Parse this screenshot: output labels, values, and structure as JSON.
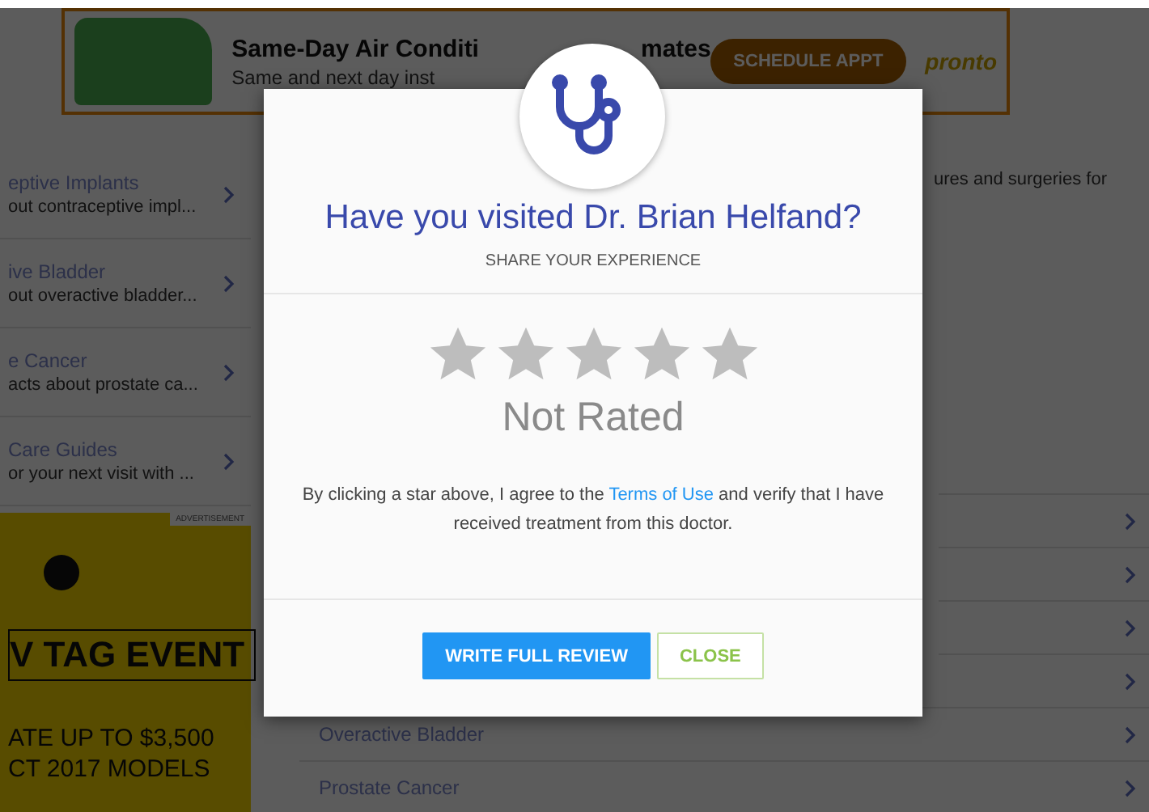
{
  "ad_banner": {
    "title_left": "Same-Day Air Conditi",
    "title_right": "mates",
    "subtitle": "Same and next day inst",
    "button": "SCHEDULE APPT",
    "logo": "pronto"
  },
  "sidebar": {
    "items": [
      {
        "title": "eptive Implants",
        "subtitle": "out contraceptive impl..."
      },
      {
        "title": "ive Bladder",
        "subtitle": "out overactive bladder..."
      },
      {
        "title": "e Cancer",
        "subtitle": "acts about prostate ca..."
      },
      {
        "title": "Care Guides",
        "subtitle": "or your next visit with ..."
      }
    ]
  },
  "side_ad": {
    "label": "ADVERTISEMENT",
    "headline": "V TAG EVENT",
    "lines": [
      "ATE UP TO $3,500",
      "CT 2017 MODELS"
    ]
  },
  "content": {
    "text": "ures and surgeries for",
    "links": [
      {
        "kind": "blank"
      },
      {
        "kind": "blank"
      },
      {
        "kind": "blank"
      },
      {
        "kind": "blank"
      },
      {
        "kind": "labeled",
        "label": "Overactive Bladder"
      },
      {
        "kind": "labeled",
        "label": "Prostate Cancer"
      }
    ]
  },
  "modal": {
    "title": "Have you visited Dr. Brian Helfand?",
    "subtitle": "SHARE YOUR EXPERIENCE",
    "stars": 0,
    "rating_label": "Not Rated",
    "consent_before": "By clicking a star above, I agree to the ",
    "consent_link": "Terms of Use",
    "consent_after": " and verify that I have received treatment from this doctor.",
    "buttons": [
      {
        "label": "WRITE FULL REVIEW",
        "kind": "primary"
      },
      {
        "label": "CLOSE",
        "kind": "outline"
      }
    ]
  }
}
